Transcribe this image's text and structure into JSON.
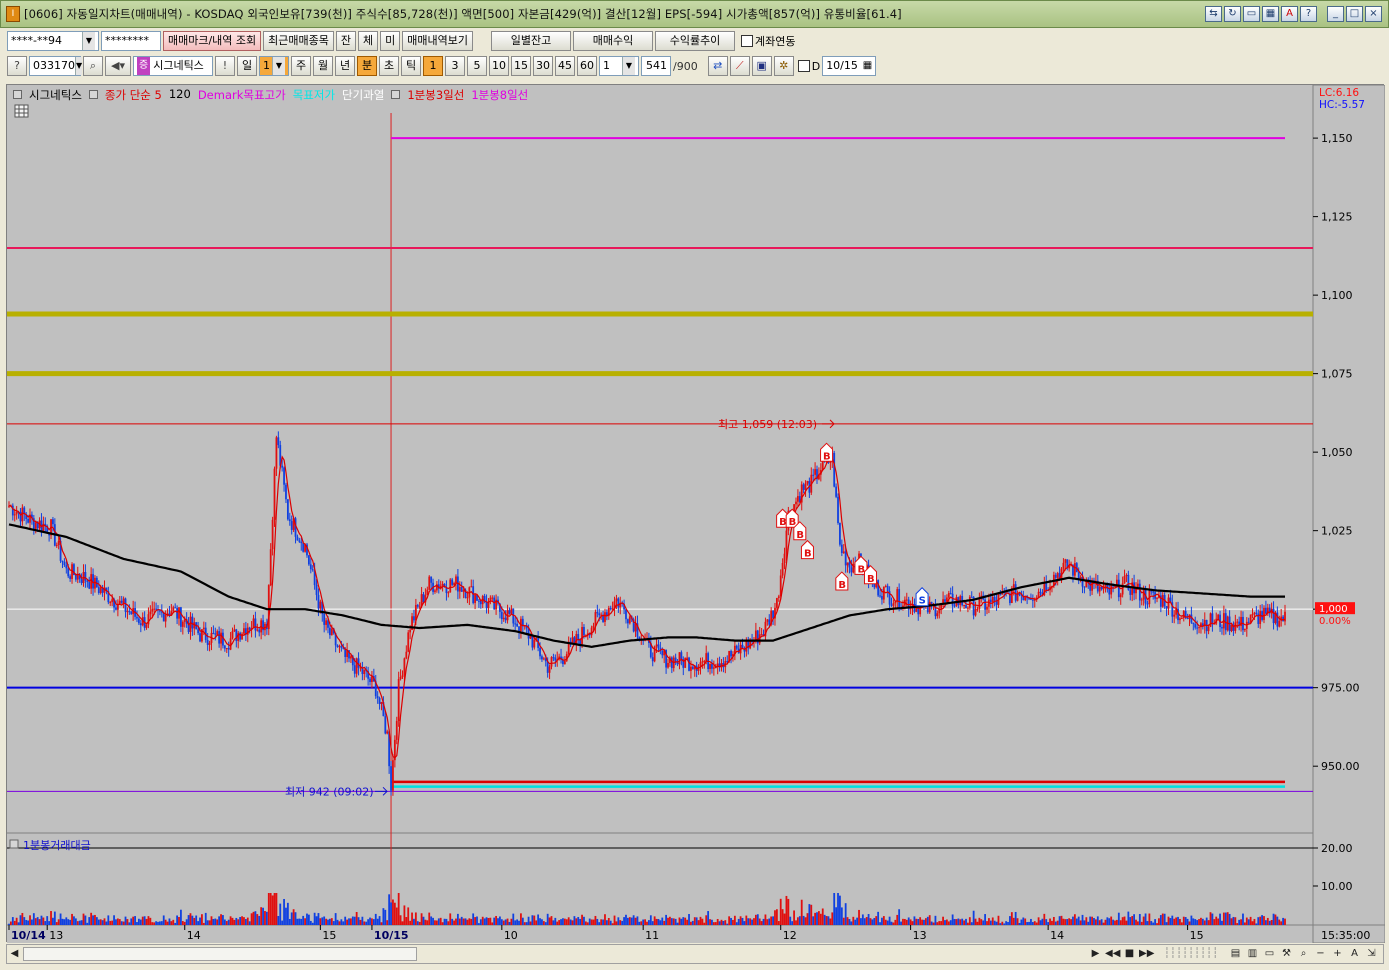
{
  "window": {
    "title": "[0606] 자동일지차트(매매내역) - KOSDAQ 외국인보유[739(천)] 주식수[85,728(천)] 액면[500] 자본금[429(억)] 결산[12월] EPS[-594] 시가총액[857(억)] 유통비율[61.4]"
  },
  "toolbar1": {
    "account": "****-**94",
    "password": "********",
    "buttons": [
      "매매마크/내역 조회",
      "최근매매종목",
      "잔",
      "체",
      "미",
      "매매내역보기"
    ],
    "right_buttons": [
      "일별잔고",
      "매매수익",
      "수익률추이"
    ],
    "checkbox_label": "계좌연동"
  },
  "toolbar2": {
    "code": "033170",
    "name": "시그네틱스",
    "exclaim": "!",
    "period_label": "일",
    "period_value": "1",
    "periods": [
      "주",
      "월",
      "년",
      "분",
      "초",
      "틱"
    ],
    "minute_values": [
      "1",
      "3",
      "5",
      "10",
      "15",
      "30",
      "45",
      "60"
    ],
    "count": "1",
    "bars": "541",
    "bars_total": "/900",
    "d_label": "D",
    "date": "10/15"
  },
  "legend": {
    "items": [
      {
        "text": "시그네틱스",
        "color": "#000000"
      },
      {
        "text": "종가 단순 5",
        "color": "#dc0000"
      },
      {
        "text": "120",
        "color": "#000000"
      },
      {
        "text": "Demark목표고가",
        "color": "#e000e0"
      },
      {
        "text": "목표저가",
        "color": "#00ffff"
      },
      {
        "text": "단기과열",
        "color": "#ffffff"
      },
      {
        "text": "1분봉3일선",
        "color": "#dc0000"
      },
      {
        "text": "1분봉8일선",
        "color": "#e000e0"
      }
    ]
  },
  "chart_data": {
    "type": "candlestick",
    "lc_label": "LC:6.16",
    "hc_label": "HC:-5.57",
    "y_ticks": [
      "1,150",
      "1,125",
      "1,100",
      "1,075",
      "1,050",
      "1,025",
      "1,000",
      "975.00",
      "950.00"
    ],
    "ylim": [
      930,
      1165
    ],
    "current_price": "1,000",
    "current_change": "0.00%",
    "high_annotation": "최고 1,059 (12:03)",
    "low_annotation": "최저 942 (09:02)",
    "x_labels": [
      "10/14",
      "13",
      "14",
      "15",
      "10/15",
      "10",
      "11",
      "12",
      "13",
      "14",
      "15"
    ],
    "time_label": "15:35:00",
    "horizontal_levels": [
      {
        "value": 1150,
        "color": "#e000e0"
      },
      {
        "value": 1115,
        "color": "#e8185a"
      },
      {
        "value": 1094,
        "color": "#b8b000"
      },
      {
        "value": 1075,
        "color": "#b8b000"
      },
      {
        "value": 1059,
        "color": "#dc0000"
      },
      {
        "value": 975,
        "color": "#0000e0"
      },
      {
        "value": 945,
        "color": "#dc0000"
      },
      {
        "value": 943.5,
        "color": "#00e0e0"
      },
      {
        "value": 942,
        "color": "#7a00e0"
      }
    ],
    "markers": [
      {
        "type": "B",
        "x_index": 405,
        "value": 1028
      },
      {
        "type": "B",
        "x_index": 410,
        "value": 1028
      },
      {
        "type": "B",
        "x_index": 414,
        "value": 1024
      },
      {
        "type": "B",
        "x_index": 418,
        "value": 1018
      },
      {
        "type": "B",
        "x_index": 428,
        "value": 1049
      },
      {
        "type": "B",
        "x_index": 436,
        "value": 1008
      },
      {
        "type": "B",
        "x_index": 446,
        "value": 1013
      },
      {
        "type": "B",
        "x_index": 451,
        "value": 1010
      },
      {
        "type": "S",
        "x_index": 478,
        "value": 1003
      }
    ],
    "close_series_anchors": [
      [
        0,
        1033
      ],
      [
        12,
        1028
      ],
      [
        22,
        1026
      ],
      [
        30,
        1012
      ],
      [
        40,
        1010
      ],
      [
        55,
        1003
      ],
      [
        70,
        996
      ],
      [
        85,
        1000
      ],
      [
        100,
        992
      ],
      [
        115,
        990
      ],
      [
        125,
        995
      ],
      [
        135,
        996
      ],
      [
        140,
        1055
      ],
      [
        146,
        1030
      ],
      [
        155,
        1020
      ],
      [
        165,
        995
      ],
      [
        175,
        985
      ],
      [
        185,
        980
      ],
      [
        192,
        975
      ],
      [
        198,
        960
      ],
      [
        200,
        944
      ],
      [
        204,
        975
      ],
      [
        210,
        995
      ],
      [
        220,
        1008
      ],
      [
        235,
        1008
      ],
      [
        250,
        1002
      ],
      [
        262,
        998
      ],
      [
        272,
        992
      ],
      [
        282,
        982
      ],
      [
        290,
        985
      ],
      [
        300,
        992
      ],
      [
        310,
        998
      ],
      [
        318,
        1003
      ],
      [
        326,
        997
      ],
      [
        335,
        987
      ],
      [
        345,
        984
      ],
      [
        360,
        983
      ],
      [
        375,
        984
      ],
      [
        385,
        988
      ],
      [
        395,
        993
      ],
      [
        402,
        1002
      ],
      [
        408,
        1030
      ],
      [
        415,
        1038
      ],
      [
        420,
        1040
      ],
      [
        426,
        1046
      ],
      [
        431,
        1048
      ],
      [
        435,
        1020
      ],
      [
        440,
        1014
      ],
      [
        446,
        1015
      ],
      [
        452,
        1008
      ],
      [
        462,
        1004
      ],
      [
        472,
        1002
      ],
      [
        482,
        1000
      ],
      [
        495,
        1003
      ],
      [
        505,
        1001
      ],
      [
        515,
        1002
      ],
      [
        525,
        1005
      ],
      [
        538,
        1005
      ],
      [
        548,
        1011
      ],
      [
        555,
        1014
      ],
      [
        565,
        1008
      ],
      [
        575,
        1005
      ],
      [
        585,
        1008
      ],
      [
        595,
        1004
      ],
      [
        605,
        1003
      ],
      [
        615,
        997
      ],
      [
        625,
        996
      ],
      [
        635,
        996
      ],
      [
        645,
        995
      ],
      [
        655,
        998
      ],
      [
        668,
        997
      ]
    ],
    "ma_series_anchors": [
      [
        0,
        1027
      ],
      [
        30,
        1023
      ],
      [
        60,
        1016
      ],
      [
        90,
        1012
      ],
      [
        115,
        1004
      ],
      [
        135,
        1000
      ],
      [
        155,
        1000
      ],
      [
        175,
        998
      ],
      [
        195,
        995
      ],
      [
        215,
        994
      ],
      [
        240,
        995
      ],
      [
        265,
        993
      ],
      [
        285,
        990
      ],
      [
        305,
        988
      ],
      [
        325,
        990
      ],
      [
        345,
        991
      ],
      [
        360,
        991
      ],
      [
        380,
        990
      ],
      [
        400,
        990
      ],
      [
        420,
        994
      ],
      [
        440,
        998
      ],
      [
        460,
        1000
      ],
      [
        480,
        1001
      ],
      [
        505,
        1003
      ],
      [
        530,
        1007
      ],
      [
        555,
        1010
      ],
      [
        575,
        1008
      ],
      [
        600,
        1006
      ],
      [
        625,
        1005
      ],
      [
        650,
        1004
      ],
      [
        668,
        1004
      ]
    ],
    "volume_panel": {
      "title": "1분봉거래대금",
      "y_ticks": [
        "20.00",
        "10.00"
      ]
    }
  }
}
